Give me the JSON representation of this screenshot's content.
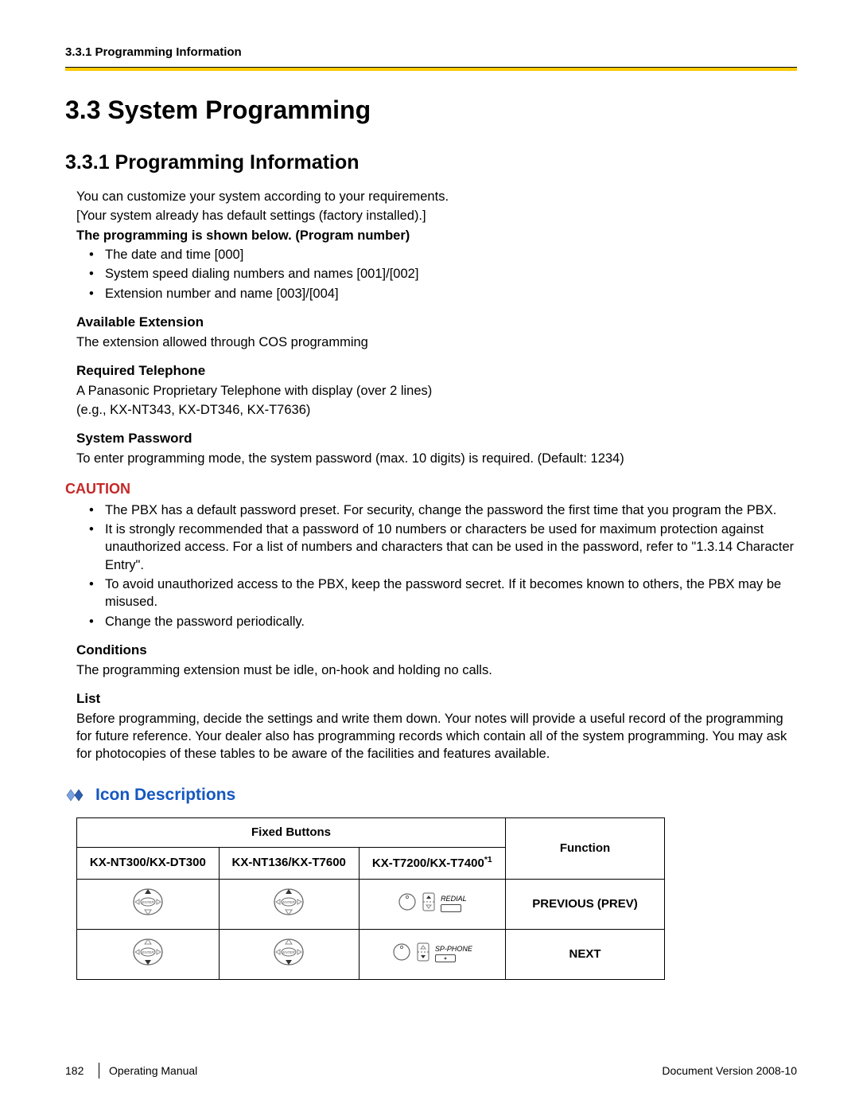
{
  "header": {
    "running": "3.3.1 Programming Information"
  },
  "h1": "3.3   System Programming",
  "h2": "3.3.1   Programming Information",
  "intro": {
    "p1": "You can customize your system according to your requirements.",
    "p2": "[Your system already has default settings (factory installed).]",
    "p3": "The programming is shown below. (Program number)",
    "bullets": {
      "b1": "The date and time [000]",
      "b2": "System speed dialing numbers and names [001]/[002]",
      "b3": "Extension number and name [003]/[004]"
    }
  },
  "availExt": {
    "head": "Available Extension",
    "body": "The extension allowed through COS programming"
  },
  "reqTel": {
    "head": "Required Telephone",
    "l1": "A Panasonic Proprietary Telephone with display (over 2 lines)",
    "l2": "(e.g., KX-NT343, KX-DT346, KX-T7636)"
  },
  "sysPwd": {
    "head": "System Password",
    "body": "To enter programming mode, the system password (max. 10 digits) is required. (Default: 1234)"
  },
  "caution": {
    "label": "CAUTION",
    "b1": "The PBX has a default password preset. For security, change the password the first time that you program the PBX.",
    "b2": "It is strongly recommended that a password of 10 numbers or characters be used for maximum protection against unauthorized access. For a list of numbers and characters that can be used in the password, refer to \"1.3.14  Character Entry\".",
    "b3": "To avoid unauthorized access to the PBX, keep the password secret. If it becomes known to others, the PBX may be misused.",
    "b4": "Change the password periodically."
  },
  "conditions": {
    "head": "Conditions",
    "body": "The programming extension must be idle, on-hook and holding no calls."
  },
  "list": {
    "head": "List",
    "body": "Before programming, decide the settings and write them down. Your notes will provide a useful record of the programming for future reference. Your dealer also has programming records which contain all of the system programming. You may ask for photocopies of these tables to be aware of the facilities and features available."
  },
  "iconDesc": {
    "title": "Icon Descriptions",
    "th_fixed": "Fixed Buttons",
    "th_fn": "Function",
    "col1": "KX-NT300/KX-DT300",
    "col2": "KX-NT136/KX-T7600",
    "col3_a": "KX-T7200/KX-T7400",
    "col3_sup": "*1",
    "row1_fn": "PREVIOUS (PREV)",
    "row2_fn": "NEXT",
    "redial": "REDIAL",
    "spphone": "SP-PHONE"
  },
  "footer": {
    "page": "182",
    "manual": "Operating Manual",
    "docver": "Document Version  2008-10"
  }
}
